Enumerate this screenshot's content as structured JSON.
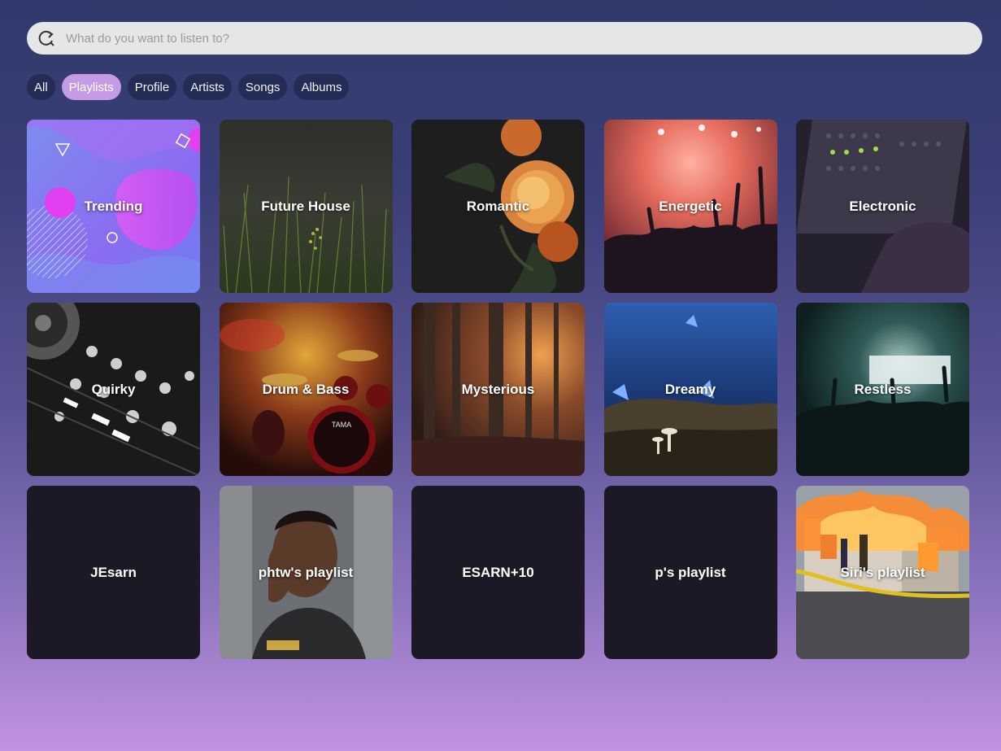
{
  "search": {
    "placeholder": "What do you want to listen to?"
  },
  "filters": [
    {
      "label": "All",
      "active": false
    },
    {
      "label": "Playlists",
      "active": true
    },
    {
      "label": "Profile",
      "active": false
    },
    {
      "label": "Artists",
      "active": false
    },
    {
      "label": "Songs",
      "active": false
    },
    {
      "label": "Albums",
      "active": false
    }
  ],
  "tiles": [
    {
      "label": "Trending",
      "art": "trending-shapes"
    },
    {
      "label": "Future House",
      "art": "grass-photo"
    },
    {
      "label": "Romantic",
      "art": "roses-photo"
    },
    {
      "label": "Energetic",
      "art": "concert-red-photo"
    },
    {
      "label": "Electronic",
      "art": "mixer-photo"
    },
    {
      "label": "Quirky",
      "art": "dj-controller-photo"
    },
    {
      "label": "Drum & Bass",
      "art": "drum-kit-photo"
    },
    {
      "label": "Mysterious",
      "art": "forest-photo"
    },
    {
      "label": "Dreamy",
      "art": "butterflies-photo"
    },
    {
      "label": "Restless",
      "art": "concert-teal-photo"
    },
    {
      "label": "JEsarn",
      "art": "none"
    },
    {
      "label": "phtw's playlist",
      "art": "man-thinking-photo"
    },
    {
      "label": "ESARN+10",
      "art": "none"
    },
    {
      "label": "p's playlist",
      "art": "none"
    },
    {
      "label": "Siri's playlist",
      "art": "house-fire-photo"
    }
  ],
  "colors": {
    "chip_bg": "#232c55",
    "chip_active": "#c59be6",
    "empty_tile": "#1c1826",
    "search_bg": "#e6e6e6"
  }
}
